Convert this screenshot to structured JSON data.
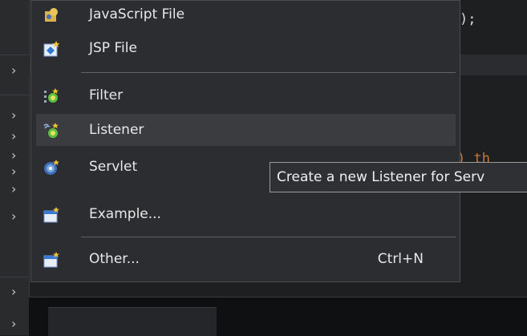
{
  "menu": {
    "items": [
      {
        "label": "JavaScript File",
        "icon": "javascript-file-icon"
      },
      {
        "label": "JSP File",
        "icon": "jsp-file-icon"
      },
      {
        "label": "Filter",
        "icon": "filter-icon"
      },
      {
        "label": "Listener",
        "icon": "listener-icon",
        "highlighted": true
      },
      {
        "label": "Servlet",
        "icon": "servlet-icon"
      },
      {
        "label": "Example...",
        "icon": "example-icon"
      },
      {
        "label": "Other...",
        "icon": "other-icon",
        "shortcut": "Ctrl+N"
      }
    ]
  },
  "tooltip": {
    "text": "Create a new Listener for Serv"
  },
  "editor": {
    "code_fragment_1": ");",
    "code_fragment_2": ") th"
  },
  "colors": {
    "menu_bg": "#2b2d30",
    "highlight": "#3a3c40",
    "text": "#e8e8e8",
    "keyword": "#cc7832"
  }
}
